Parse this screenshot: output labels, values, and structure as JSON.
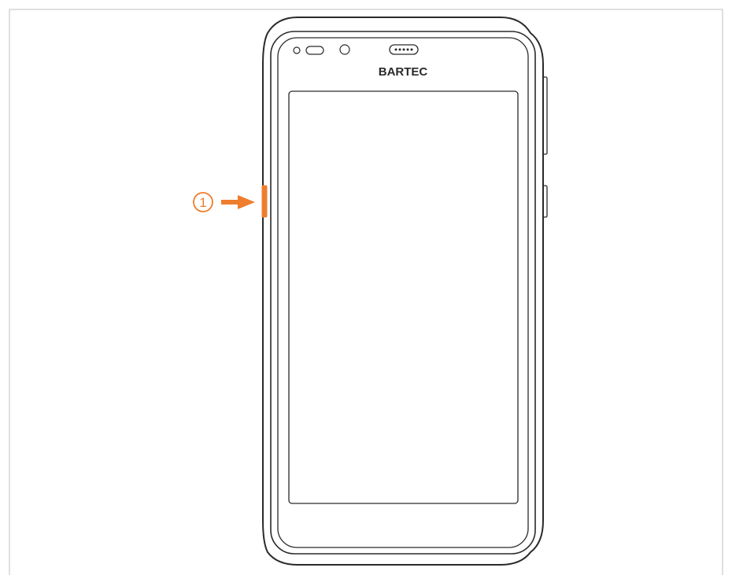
{
  "figure": {
    "brand_text": "BARTEC",
    "callout_number": "1",
    "callout_target": "side-button-left"
  },
  "colors": {
    "accent": "#ee7d2d",
    "line": "#2a2a2a",
    "border": "#bfbfbf",
    "background": "#ffffff"
  }
}
